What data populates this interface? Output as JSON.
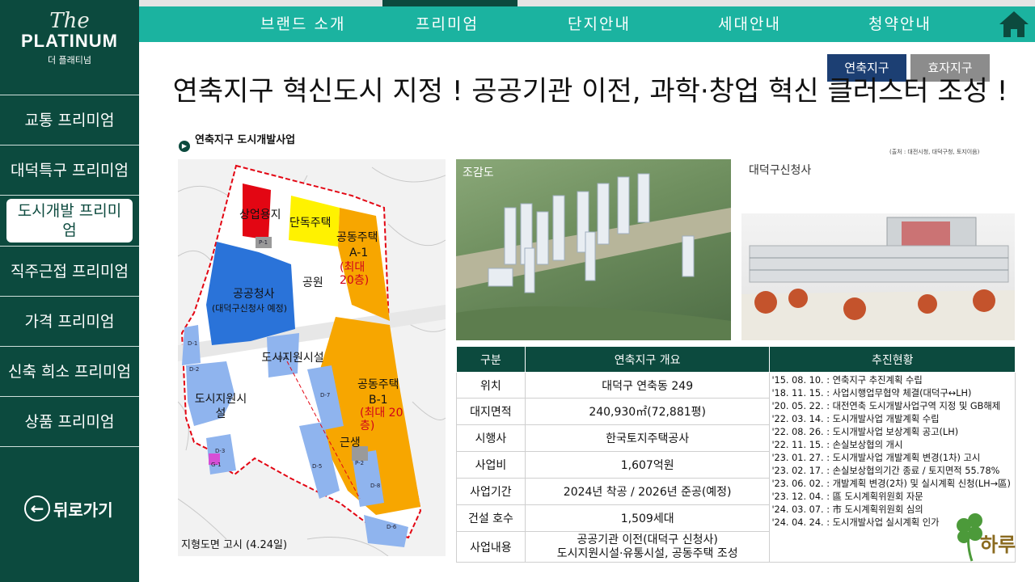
{
  "brand": {
    "the": "The",
    "name": "PLATINUM",
    "korean": "더 플래티넘"
  },
  "nav": {
    "tabs": [
      "브랜드 소개",
      "프리미엄",
      "단지안내",
      "세대안내",
      "청약안내"
    ],
    "active_tab": "프리미엄"
  },
  "sidebar": {
    "items": [
      {
        "label": "교통 프리미엄"
      },
      {
        "label": "대덕특구 프리미엄"
      },
      {
        "label": "도시개발 프리미엄"
      },
      {
        "label": "직주근접 프리미엄"
      },
      {
        "label": "가격 프리미엄"
      },
      {
        "label": "신축 희소 프리미엄"
      },
      {
        "label": "상품 프리미엄"
      }
    ],
    "active_item": "도시개발 프리미엄",
    "back_label": "뒤로가기"
  },
  "district_buttons": {
    "yeonchuk": "연축지구",
    "hyoja": "효자지구"
  },
  "title": "연축지구 혁신도시 지정 ! 공공기관 이전, 과학·창업 혁신 클러스터 조성 !",
  "source": "(출처 : 대전시청, 대덕구청, 토지이음)",
  "map": {
    "title": "연축지구 도시개발사업",
    "caption": "지형도면 고시 (4.24일)",
    "labels": {
      "commercial": "상업용지",
      "detached": "단독주택",
      "apt_a1": "공동주택",
      "apt_a1_code": "A-1",
      "apt_a1_height": "(최대 20층)",
      "park": "공원",
      "gov": "공공청사",
      "gov_note": "(대덕구신청사 예정)",
      "support1": "도시지원시설",
      "support2": "도시지원시설",
      "apt_b1": "공동주택",
      "apt_b1_code": "B-1",
      "apt_b1_height": "(최대 20층)",
      "neighborhood": "근생"
    },
    "tags": [
      "P-1",
      "D-1",
      "D-2",
      "D-3",
      "G-1",
      "D-4",
      "D-5",
      "D-6",
      "D-7",
      "D-8",
      "P-2"
    ]
  },
  "photos": {
    "birdseye": "조감도",
    "cityhall": "대덕구신청사"
  },
  "table": {
    "headers": [
      "구분",
      "연축지구 개요",
      "추진현황"
    ],
    "rows": [
      {
        "label": "위치",
        "value": "대덕구 연축동 249"
      },
      {
        "label": "대지면적",
        "value": "240,930㎡(72,881평)"
      },
      {
        "label": "시행사",
        "value": "한국토지주택공사"
      },
      {
        "label": "사업비",
        "value": "1,607억원"
      },
      {
        "label": "사업기간",
        "value": "2024년 착공 / 2026년 준공(예정)"
      },
      {
        "label": "건설 호수",
        "value": "1,509세대"
      },
      {
        "label": "사업내용",
        "value": "공공기관 이전(대덕구 신청사)",
        "value2": "도시지원시설·유통시설, 공동주택 조성"
      }
    ],
    "status": [
      "'15. 08. 10. : 연축지구 추진계획 수립",
      "'18. 11. 15. : 사업시행업무협약 체결(대덕구↔LH)",
      "'20. 05. 22. : 대전연축 도시개발사업구역 지정 및 GB해제",
      "'22. 03. 14. : 도시개발사업 개발계획 수립",
      "'22. 08. 26. : 도시개발사업 보상계획 공고(LH)",
      "'22. 11. 15. : 손실보상협의 개시",
      "'23. 01. 27. : 도시개발사업 개발계획 변경(1차) 고시",
      "'23. 02. 17. : 손실보상협의기간 종료 / 토지면적 55.78%",
      "'23. 06. 02. : 개발계획 변경(2차) 및 실시계획 신청(LH→區)",
      "'23. 12. 04. : 區 도시계획위원회 자문",
      "'24. 03. 07. : 市 도시계획위원회 심의",
      "'24. 04. 24. : 도시개발사업 실시계획 인가"
    ]
  },
  "watermark": "하루",
  "colors": {
    "sidebar": "#0c4a3e",
    "topbar": "#1bb3a0",
    "btn_active": "#1c3f73",
    "btn_inactive": "#8c8c8c",
    "apt_zone": "#f7a600",
    "public_zone": "#2a73d9",
    "commercial_zone": "#e30613"
  }
}
